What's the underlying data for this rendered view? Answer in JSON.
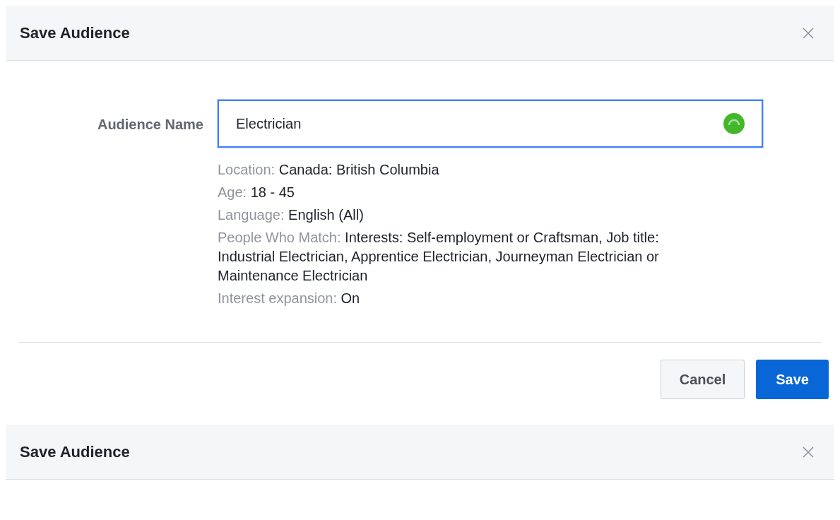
{
  "dialog": {
    "title": "Save Audience",
    "field": {
      "label": "Audience Name",
      "value": "Electrician",
      "focused": true
    },
    "details": [
      {
        "label": "Location:",
        "value": "Canada: British Columbia"
      },
      {
        "label": "Age:",
        "value": "18 - 45"
      },
      {
        "label": "Language:",
        "value": "English (All)"
      },
      {
        "label": "People Who Match:",
        "value": "Interests: Self-employment or Craftsman, Job title: Industrial Electrician, Apprentice Electrician, Journeyman Electrician or Maintenance Electrician"
      },
      {
        "label": "Interest expansion:",
        "value": "On"
      }
    ],
    "buttons": [
      {
        "label": "Cancel",
        "kind": "secondary"
      },
      {
        "label": "Save",
        "kind": "primary"
      }
    ]
  },
  "second_dialog": {
    "title": "Save Audience"
  }
}
